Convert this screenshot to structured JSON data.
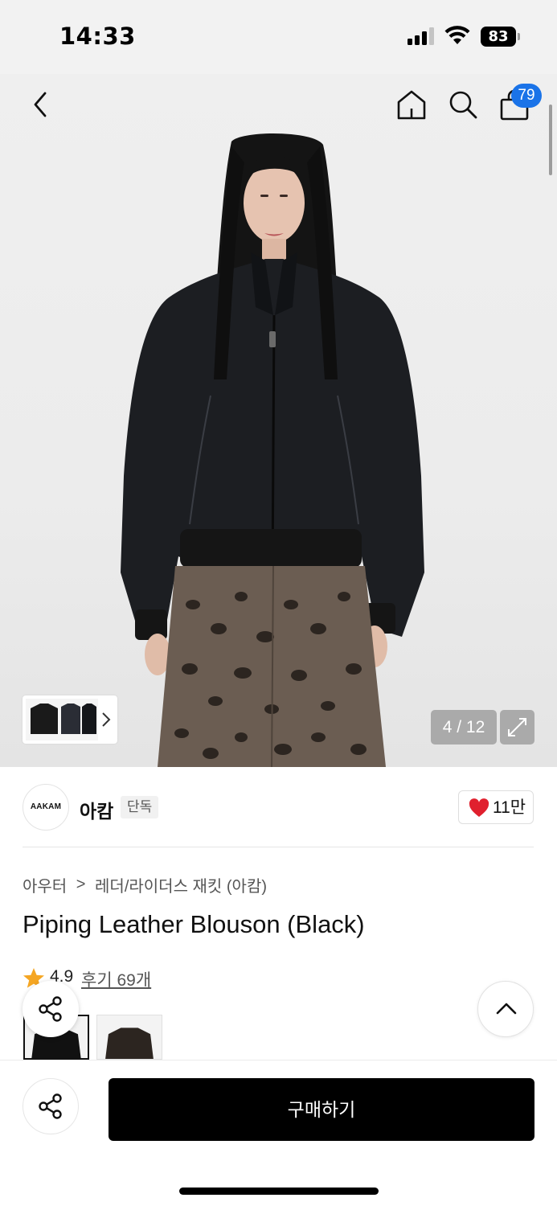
{
  "status_bar": {
    "time": "14:33",
    "battery": "83"
  },
  "nav": {
    "cart_count": "79"
  },
  "gallery": {
    "page_counter": "4 / 12"
  },
  "brand": {
    "logo_text": "AAKAM",
    "name": "아캄",
    "badge": "단독",
    "likes": "11만"
  },
  "breadcrumb": {
    "level1": "아우터",
    "separator": ">",
    "level2": "레더/라이더스 재킷 (아캄)"
  },
  "product": {
    "title": "Piping Leather Blouson (Black)"
  },
  "rating": {
    "value": "4.9",
    "reviews": "후기 69개"
  },
  "actions": {
    "buy_label": "구매하기"
  },
  "colors": {
    "accent_blue": "#1a73e8",
    "heart_red": "#e0202e",
    "star_orange": "#f5a623"
  }
}
